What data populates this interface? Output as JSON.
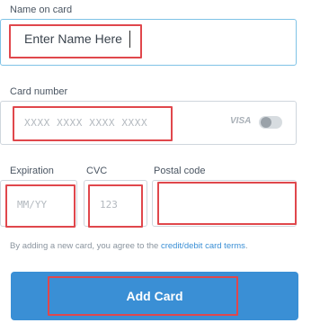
{
  "name_field": {
    "label": "Name on card",
    "value": "Enter Name Here"
  },
  "card_field": {
    "label": "Card number",
    "placeholder": "XXXX  XXXX  XXXX  XXXX",
    "brand": "VISA"
  },
  "expiration_field": {
    "label": "Expiration",
    "placeholder": "MM/YY"
  },
  "cvc_field": {
    "label": "CVC",
    "placeholder": "123"
  },
  "postal_field": {
    "label": "Postal code",
    "placeholder": ""
  },
  "terms": {
    "text": "By adding a new card, you agree to the ",
    "link": "credit/debit card terms",
    "suffix": "."
  },
  "submit": {
    "label": "Add Card"
  },
  "colors": {
    "accent": "#3a8fd5",
    "highlight": "#e0474c",
    "focus_border": "#7fc3e6"
  },
  "icons": {
    "toggle": "toggle-icon"
  }
}
